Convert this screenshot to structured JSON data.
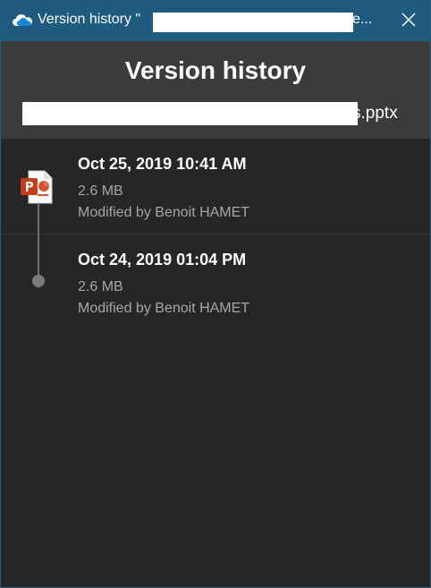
{
  "window": {
    "title_prefix": "Version history \"",
    "title_suffix": "e..."
  },
  "header": {
    "title": "Version history",
    "file_suffix": "s.pptx"
  },
  "versions": [
    {
      "date": "Oct 25, 2019 10:41 AM",
      "size": "2.6 MB",
      "modified": "Modified by Benoit HAMET",
      "icon": "powerpoint-file-icon"
    },
    {
      "date": "Oct 24, 2019 01:04 PM",
      "size": "2.6 MB",
      "modified": "Modified by Benoit HAMET",
      "icon": "timeline-dot"
    }
  ],
  "colors": {
    "titlebar": "#1f5a7f",
    "header": "#3b3b3b",
    "body": "#262626",
    "powerpoint": "#d35230"
  }
}
